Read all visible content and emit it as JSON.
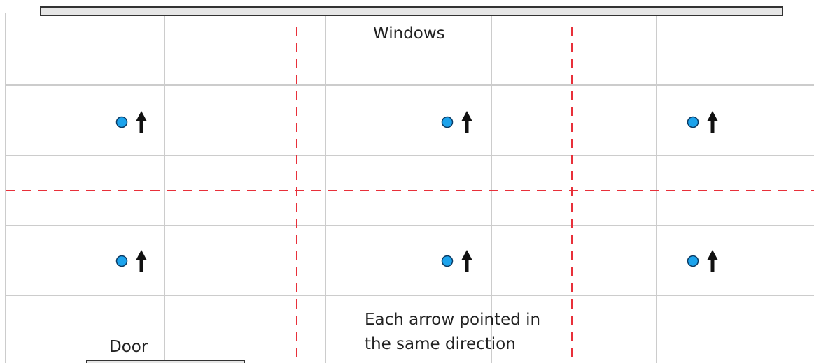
{
  "labels": {
    "windows": "Windows",
    "door": "Door",
    "note_line1": "Each arrow pointed in",
    "note_line2": "the same direction"
  },
  "markers": {
    "count": 6,
    "arrow_direction": "up",
    "dot_color": "#1ca3ec",
    "arrow_color": "#111111"
  },
  "colors": {
    "grid": "#cccccc",
    "dashed_division": "#e8303a",
    "window_bar_fill": "#e6e6e6",
    "window_bar_stroke": "#333333",
    "background": "#ffffff"
  }
}
